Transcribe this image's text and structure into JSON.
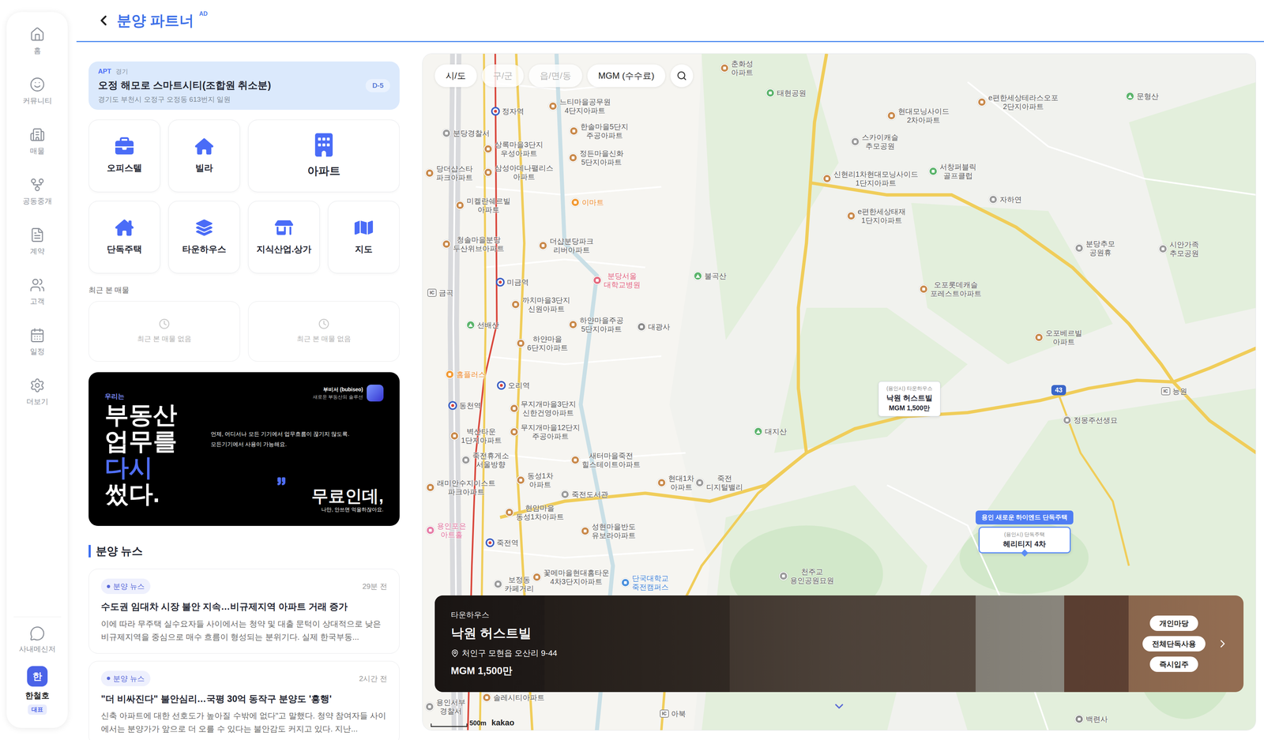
{
  "sidebar": {
    "items": [
      {
        "label": "홈",
        "selected": false
      },
      {
        "label": "커뮤니티",
        "selected": false
      },
      {
        "label": "매물",
        "selected": false
      },
      {
        "label": "공동중개",
        "selected": false
      },
      {
        "label": "계약",
        "selected": false
      },
      {
        "label": "고객",
        "selected": false
      },
      {
        "label": "일정",
        "selected": false
      },
      {
        "label": "더보기",
        "selected": false
      }
    ],
    "messenger": "사내메신저",
    "user": {
      "initial": "한",
      "name": "한철호",
      "role": "대표"
    }
  },
  "header": {
    "title": "분양 파트너",
    "badge": "AD"
  },
  "featured": {
    "type": "APT",
    "region": "경기",
    "title": "오정 해모로 스마트시티(조합원 취소분)",
    "address": "경기도 부천시 오정구 오정동 613번지 일원",
    "dday": "D-5"
  },
  "categories": [
    {
      "label": "오피스텔",
      "kind": "small"
    },
    {
      "label": "빌라",
      "kind": "small"
    },
    {
      "label": "아파트",
      "kind": "wide"
    },
    {
      "label": "단독주택",
      "kind": "small"
    },
    {
      "label": "타운하우스",
      "kind": "small"
    },
    {
      "label": "지식산업.상가",
      "kind": "small"
    },
    {
      "label": "지도",
      "kind": "small"
    }
  ],
  "recent": {
    "title": "최근 본 매물",
    "items": [
      "최근 본 매물 없음",
      "최근 본 매물 없음"
    ]
  },
  "banner": {
    "eyebrow": "우리는",
    "headline": [
      {
        "text": "부동산",
        "color": "#ffffff"
      },
      {
        "text": "업무를",
        "color": "#ffffff"
      },
      {
        "text": "다시",
        "color": "#4f6ef7"
      },
      {
        "text": "썼다.",
        "color": "#ffffff"
      }
    ],
    "description": [
      "언제, 어디서나 모든 기기에서 업무흐름이 끊기지 않도록.",
      "모든기기에서 사용이 가능해요."
    ],
    "brand": {
      "name": "부비서 (bubiseo)",
      "tagline": "새로운 부동산의 솔루션"
    },
    "cta": "무료인데,",
    "cta_caption": "나만, 안쓰면 억울하잖아요."
  },
  "news": {
    "title": "분양 뉴스",
    "items": [
      {
        "tag": "분양 뉴스",
        "time": "29분 전",
        "title": "수도권 임대차 시장 불안 지속…비규제지역 아파트 거래 증가",
        "body": "이에 따라 무주택 실수요자들 사이에서는 청약 및 대출 문턱이 상대적으로 낮은 비규제지역을 중심으로 매수 흐름이 형성되는 분위기다. 실제 한국부동..."
      },
      {
        "tag": "분양 뉴스",
        "time": "2시간 전",
        "title": "\"더 비싸진다\" 불안심리…국평 30억 동작구 분양도 '흥행'",
        "body": "신축 아파트에 대한 선호도가 높아질 수밖에 없다\"고 말했다. 청약 참여자들 사이에서는 분양가가 앞으로 더 오를 수 있다는 불안감도 커지고 있다. 지난..."
      }
    ]
  },
  "map": {
    "filters": [
      {
        "label": "시/도",
        "disabled": false
      },
      {
        "label": "구/군",
        "disabled": true
      },
      {
        "label": "읍/면/동",
        "disabled": true
      },
      {
        "label": "MGM (수수료)",
        "disabled": false
      }
    ],
    "pins": [
      {
        "lines": [
          "정자역"
        ],
        "kind": "station"
      },
      {
        "lines": [
          "느티마을공무원",
          "4단지아파트"
        ],
        "kind": "apt"
      },
      {
        "lines": [
          "한솔마을5단지",
          "주공아파트"
        ],
        "kind": "apt"
      },
      {
        "lines": [
          "분당경찰서"
        ],
        "kind": "poi"
      },
      {
        "lines": [
          "상록마을3단지",
          "우성아파트"
        ],
        "kind": "apt"
      },
      {
        "lines": [
          "정든마을신화",
          "5단지아파트"
        ],
        "kind": "apt"
      },
      {
        "lines": [
          "당더샵스타",
          "파크아파트"
        ],
        "kind": "apt"
      },
      {
        "lines": [
          "삼성아데나팰리스",
          "아파트"
        ],
        "kind": "apt"
      },
      {
        "lines": [
          "미켈란쉐르빌",
          "아파트"
        ],
        "kind": "apt"
      },
      {
        "lines": [
          "이마트"
        ],
        "kind": "mart"
      },
      {
        "lines": [
          "청솔마을분당",
          "두산위브아파트"
        ],
        "kind": "apt"
      },
      {
        "lines": [
          "더샵분당파크",
          "리버아파트"
        ],
        "kind": "apt"
      },
      {
        "lines": [
          "분당서울",
          "대학교병원"
        ],
        "kind": "hospital"
      },
      {
        "lines": [
          "미금역"
        ],
        "kind": "station"
      },
      {
        "lines": [
          "까치마을3단지",
          "신원아파트"
        ],
        "kind": "apt"
      },
      {
        "lines": [
          "하얀마을주공",
          "5단지아파트"
        ],
        "kind": "apt"
      },
      {
        "lines": [
          "선배산"
        ],
        "kind": "mountain"
      },
      {
        "lines": [
          "하얀마을",
          "6단지아파트"
        ],
        "kind": "apt"
      },
      {
        "lines": [
          "대광사"
        ],
        "kind": "temple"
      },
      {
        "lines": [
          "홈플러스"
        ],
        "kind": "mart"
      },
      {
        "lines": [
          "오리역"
        ],
        "kind": "station"
      },
      {
        "lines": [
          "동천역"
        ],
        "kind": "station"
      },
      {
        "lines": [
          "무지개마을3단지",
          "신한건영아파트"
        ],
        "kind": "apt"
      },
      {
        "lines": [
          "벽산타운",
          "1단지아파트"
        ],
        "kind": "apt"
      },
      {
        "lines": [
          "무지개마을12단지",
          "주공아파트"
        ],
        "kind": "apt"
      },
      {
        "lines": [
          "죽전휴게소",
          "서울방향"
        ],
        "kind": "poi"
      },
      {
        "lines": [
          "새터마을죽전",
          "힐스테이트아파트"
        ],
        "kind": "apt"
      },
      {
        "lines": [
          "현대1차",
          "아파트"
        ],
        "kind": "apt"
      },
      {
        "lines": [
          "죽전",
          "디지털밸리"
        ],
        "kind": "poi"
      },
      {
        "lines": [
          "래미안수지이스트",
          "파크아파트"
        ],
        "kind": "apt"
      },
      {
        "lines": [
          "동성1차",
          "아파트"
        ],
        "kind": "apt"
      },
      {
        "lines": [
          "죽전도서관"
        ],
        "kind": "poi"
      },
      {
        "lines": [
          "현암마을",
          "동성1차아파트"
        ],
        "kind": "apt"
      },
      {
        "lines": [
          "용인포은",
          "아트홀"
        ],
        "kind": "art"
      },
      {
        "lines": [
          "성현마을반도",
          "유보라아파트"
        ],
        "kind": "apt"
      },
      {
        "lines": [
          "죽전역"
        ],
        "kind": "station"
      },
      {
        "lines": [
          "보정동",
          "카페거리"
        ],
        "kind": "poi"
      },
      {
        "lines": [
          "꽃메마을현대홈타운",
          "4차3단지아파트"
        ],
        "kind": "apt"
      },
      {
        "lines": [
          "단국대학교",
          "죽전캠퍼스"
        ],
        "kind": "school"
      },
      {
        "lines": [
          "천주교",
          "용인공원묘원"
        ],
        "kind": "poi"
      },
      {
        "lines": [
          "솔레시티아파트"
        ],
        "kind": "apt"
      },
      {
        "lines": [
          "용인서부",
          "경찰서"
        ],
        "kind": "poi"
      },
      {
        "lines": [
          "아북"
        ],
        "kind": "ic"
      },
      {
        "lines": [
          "백련사"
        ],
        "kind": "temple"
      },
      {
        "lines": [
          "태현공원"
        ],
        "kind": "park"
      },
      {
        "lines": [
          "춘화성",
          "아파트"
        ],
        "kind": "apt"
      },
      {
        "lines": [
          "현대모닝사이드",
          "2차아파트"
        ],
        "kind": "apt"
      },
      {
        "lines": [
          "e편한세상테라스오포",
          "2단지아파트"
        ],
        "kind": "apt"
      },
      {
        "lines": [
          "스카이캐슬",
          "추모공원"
        ],
        "kind": "poi"
      },
      {
        "lines": [
          "서창퍼블릭",
          "골프클럽"
        ],
        "kind": "golf"
      },
      {
        "lines": [
          "신현리1차현대모닝사이드",
          "1단지아파트"
        ],
        "kind": "apt"
      },
      {
        "lines": [
          "자하연"
        ],
        "kind": "poi"
      },
      {
        "lines": [
          "e편한세상태재",
          "1단지아파트"
        ],
        "kind": "apt"
      },
      {
        "lines": [
          "불곡산"
        ],
        "kind": "mountain"
      },
      {
        "lines": [
          "분당추모",
          "공원휴"
        ],
        "kind": "poi"
      },
      {
        "lines": [
          "시안가족",
          "추모공원"
        ],
        "kind": "poi"
      },
      {
        "lines": [
          "오포롯데캐슬",
          "포레스트아파트"
        ],
        "kind": "apt"
      },
      {
        "lines": [
          "오포베르빌",
          "아파트"
        ],
        "kind": "apt"
      },
      {
        "lines": [
          "문형산"
        ],
        "kind": "mountain"
      },
      {
        "lines": [
          "정몽주선생묘"
        ],
        "kind": "poi"
      },
      {
        "lines": [
          "대지산"
        ],
        "kind": "mountain"
      },
      {
        "lines": [
          "능원"
        ],
        "kind": "ic"
      },
      {
        "lines": [
          "금곡"
        ],
        "kind": "ic"
      }
    ],
    "ic_label": "IC",
    "route_shield": "43",
    "markers": [
      {
        "region": "(용인시) 타운하우스",
        "name": "낙원 허스트빌",
        "fee": "MGM 1,500만",
        "selected": false
      },
      {
        "headline": "용인 새로운 하이엔드 단독주택",
        "region": "(용인시) 단독주택",
        "name": "헤리티지 4차",
        "selected": true
      }
    ],
    "card": {
      "type": "타운하우스",
      "name": "낙원 허스트빌",
      "address": "처인구 모현읍 오산리 9-44",
      "fee": "MGM 1,500만",
      "tags": [
        "개인마당",
        "전체단독사용",
        "즉시입주"
      ]
    },
    "scale": "500m",
    "attribution": "kakao"
  }
}
